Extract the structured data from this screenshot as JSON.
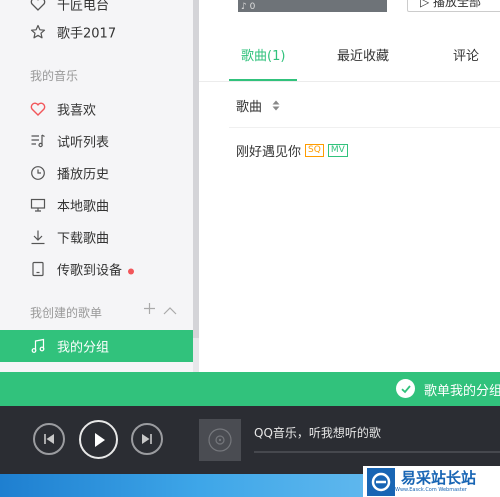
{
  "sidebar": {
    "items_top": [
      {
        "label": "千匠电台",
        "icon": "heart-icon"
      },
      {
        "label": "歌手2017",
        "icon": "star-icon"
      }
    ],
    "my_music_title": "我的音乐",
    "my_music": [
      {
        "label": "我喜欢",
        "icon": "heart-icon"
      },
      {
        "label": "试听列表",
        "icon": "playlist-icon"
      },
      {
        "label": "播放历史",
        "icon": "clock-icon"
      },
      {
        "label": "本地歌曲",
        "icon": "monitor-icon"
      },
      {
        "label": "下载歌曲",
        "icon": "download-icon"
      },
      {
        "label": "传歌到设备",
        "icon": "device-icon"
      }
    ],
    "created_title": "我创建的歌单",
    "created_items": [
      {
        "label": "我的分组",
        "icon": "music-note-icon"
      }
    ],
    "heart_color": "#f2565a",
    "accent": "#31c27c"
  },
  "main": {
    "top_button": "▷ 播放全部",
    "top_image_text": "♪ 0",
    "tabs": [
      {
        "label": "歌曲(1)",
        "active": true
      },
      {
        "label": "最近收藏",
        "active": false
      },
      {
        "label": "评论",
        "active": false
      }
    ],
    "column_header": "歌曲",
    "songs": [
      {
        "title": "刚好遇见你",
        "badges": [
          "SQ",
          "MV"
        ]
      }
    ]
  },
  "toast": {
    "message": "歌单我的分组"
  },
  "player": {
    "now_playing": "QQ音乐，听我想听的歌",
    "progress": 0
  },
  "watermark": {
    "title": "易采站长站",
    "subtitle": "Www.Easck.Com  Webmaster"
  }
}
